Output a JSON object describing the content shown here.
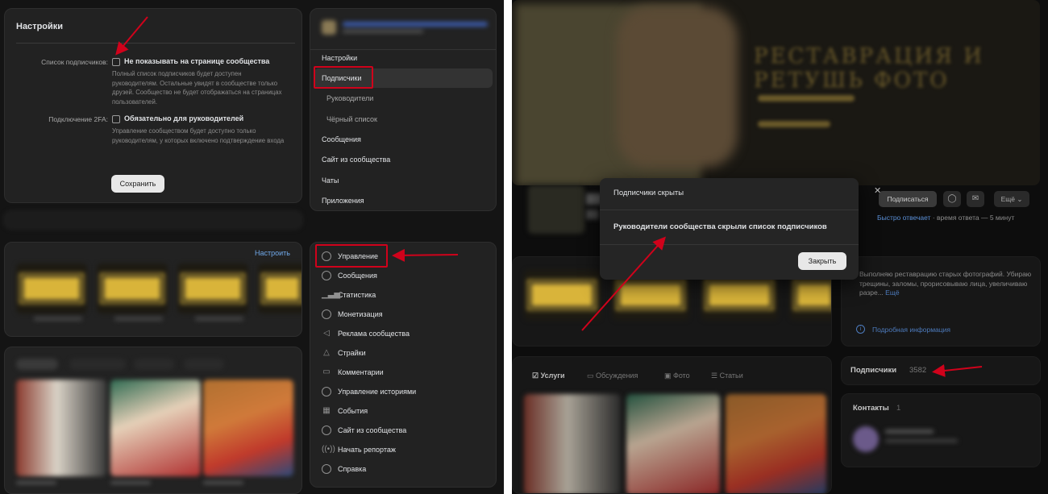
{
  "left": {
    "settings": {
      "title": "Настройки",
      "subscribers_list_label": "Список подписчиков:",
      "hide_checkbox_label": "Не показывать на странице сообщества",
      "hide_checkbox_desc": "Полный список подписчиков будет доступен руководителям. Остальные увидят в сообществе только друзей. Сообщество не будет отображаться на страницах пользователей.",
      "twofa_label": "Подключение 2FA:",
      "twofa_checkbox_label": "Обязательно для руководителей",
      "twofa_desc": "Управление сообществом будет доступно только руководителям, у которых включено подтверждение входа",
      "save_label": "Сохранить"
    },
    "side_nav": {
      "items": [
        {
          "label": "Настройки"
        },
        {
          "label": "Подписчики"
        },
        {
          "label": "Руководители"
        },
        {
          "label": "Чёрный список"
        },
        {
          "label": "Сообщения"
        },
        {
          "label": "Сайт из сообщества"
        },
        {
          "label": "Чаты"
        },
        {
          "label": "Приложения"
        }
      ]
    },
    "goods": {
      "customize_label": "Настроить"
    },
    "manage_nav": {
      "items": [
        {
          "label": "Управление",
          "icon": "gear-icon"
        },
        {
          "label": "Сообщения",
          "icon": "chat-icon"
        },
        {
          "label": "Статистика",
          "icon": "chart-icon"
        },
        {
          "label": "Монетизация",
          "icon": "coin-icon"
        },
        {
          "label": "Реклама сообщества",
          "icon": "megaphone-icon"
        },
        {
          "label": "Страйки",
          "icon": "warning-icon"
        },
        {
          "label": "Комментарии",
          "icon": "comment-icon"
        },
        {
          "label": "Управление историями",
          "icon": "stories-icon"
        },
        {
          "label": "События",
          "icon": "calendar-icon"
        },
        {
          "label": "Сайт из сообщества",
          "icon": "globe-icon"
        },
        {
          "label": "Начать репортаж",
          "icon": "broadcast-icon"
        },
        {
          "label": "Справка",
          "icon": "help-icon"
        }
      ]
    }
  },
  "right": {
    "profile": {
      "subscribe_label": "Подписаться",
      "more_label": "Ещё",
      "response_fast": "Быстро отвечает",
      "response_time": " · время ответа — 5 минут"
    },
    "about": {
      "text": "Выполняю реставрацию старых фотографий. Убираю трещины, заломы, прорисовываю лица, увеличиваю разре...",
      "more": "Ещё",
      "details_label": "Подробная информация"
    },
    "tabs": [
      {
        "label": "Услуги"
      },
      {
        "label": "Обсуждения"
      },
      {
        "label": "Фото"
      },
      {
        "label": "Статьи"
      }
    ],
    "subscribers": {
      "label": "Подписчики",
      "count": "3582"
    },
    "contacts": {
      "label": "Контакты",
      "count": "1"
    },
    "modal": {
      "title": "Подписчики скрыты",
      "body": "Руководители сообщества скрыли список подписчиков",
      "close_label": "Закрыть",
      "x_glyph": "✕"
    }
  },
  "colors": {
    "highlight": "#d0021b",
    "link": "#71aaeb",
    "background": "#141414"
  }
}
